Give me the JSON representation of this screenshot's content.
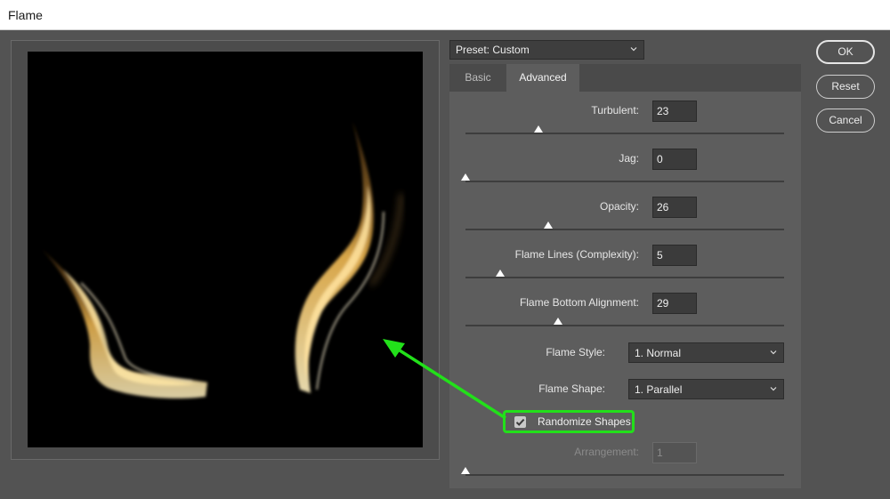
{
  "window": {
    "title": "Flame"
  },
  "preset": {
    "label": "Preset: Custom"
  },
  "tabs": [
    {
      "label": "Basic",
      "active": false
    },
    {
      "label": "Advanced",
      "active": true
    }
  ],
  "fields": {
    "turbulent": {
      "label": "Turbulent:",
      "value": "23",
      "slider": 0.23
    },
    "jag": {
      "label": "Jag:",
      "value": "0",
      "slider": 0.0
    },
    "opacity": {
      "label": "Opacity:",
      "value": "26",
      "slider": 0.26
    },
    "flame_lines": {
      "label": "Flame Lines (Complexity):",
      "value": "5",
      "slider": 0.11
    },
    "flame_bottom": {
      "label": "Flame Bottom Alignment:",
      "value": "29",
      "slider": 0.29
    },
    "arrangement": {
      "label": "Arrangement:",
      "value": "1",
      "slider": 0.0,
      "disabled": true
    }
  },
  "flame_style": {
    "label": "Flame Style:",
    "value": "1. Normal"
  },
  "flame_shape": {
    "label": "Flame Shape:",
    "value": "1. Parallel"
  },
  "randomize": {
    "label": "Randomize Shapes",
    "checked": true,
    "highlight_color": "#22e01a"
  },
  "buttons": {
    "ok": "OK",
    "reset": "Reset",
    "cancel": "Cancel"
  },
  "colors": {
    "flame": "#f0c060",
    "annotation": "#22e01a"
  }
}
